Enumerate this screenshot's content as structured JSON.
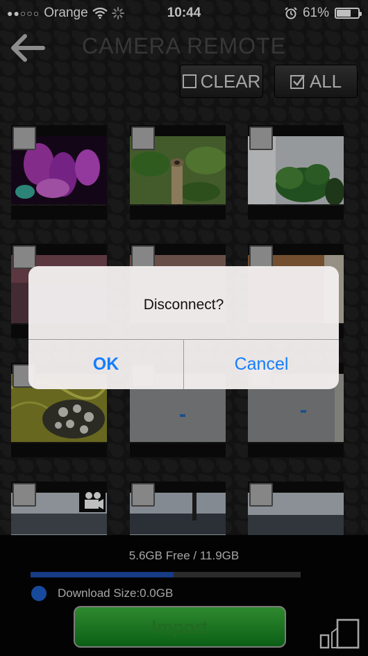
{
  "status": {
    "carrier": "Orange",
    "time": "10:44",
    "battery_percent": "61%",
    "battery_level": 0.61
  },
  "header": {
    "title": "CAMERA REMOTE",
    "clear_label": "CLEAR",
    "all_label": "ALL"
  },
  "storage": {
    "free_text": "5.6GB Free / 11.9GB",
    "used_fraction": 0.53,
    "download_size_text": "Download Size:0.0GB",
    "import_label": "Import"
  },
  "dialog": {
    "message": "Disconnect?",
    "ok_label": "OK",
    "cancel_label": "Cancel"
  },
  "colors": {
    "accent_blue": "#147efb",
    "import_green": "#1f9a2a",
    "storage_bar": "#1f4fb0"
  }
}
